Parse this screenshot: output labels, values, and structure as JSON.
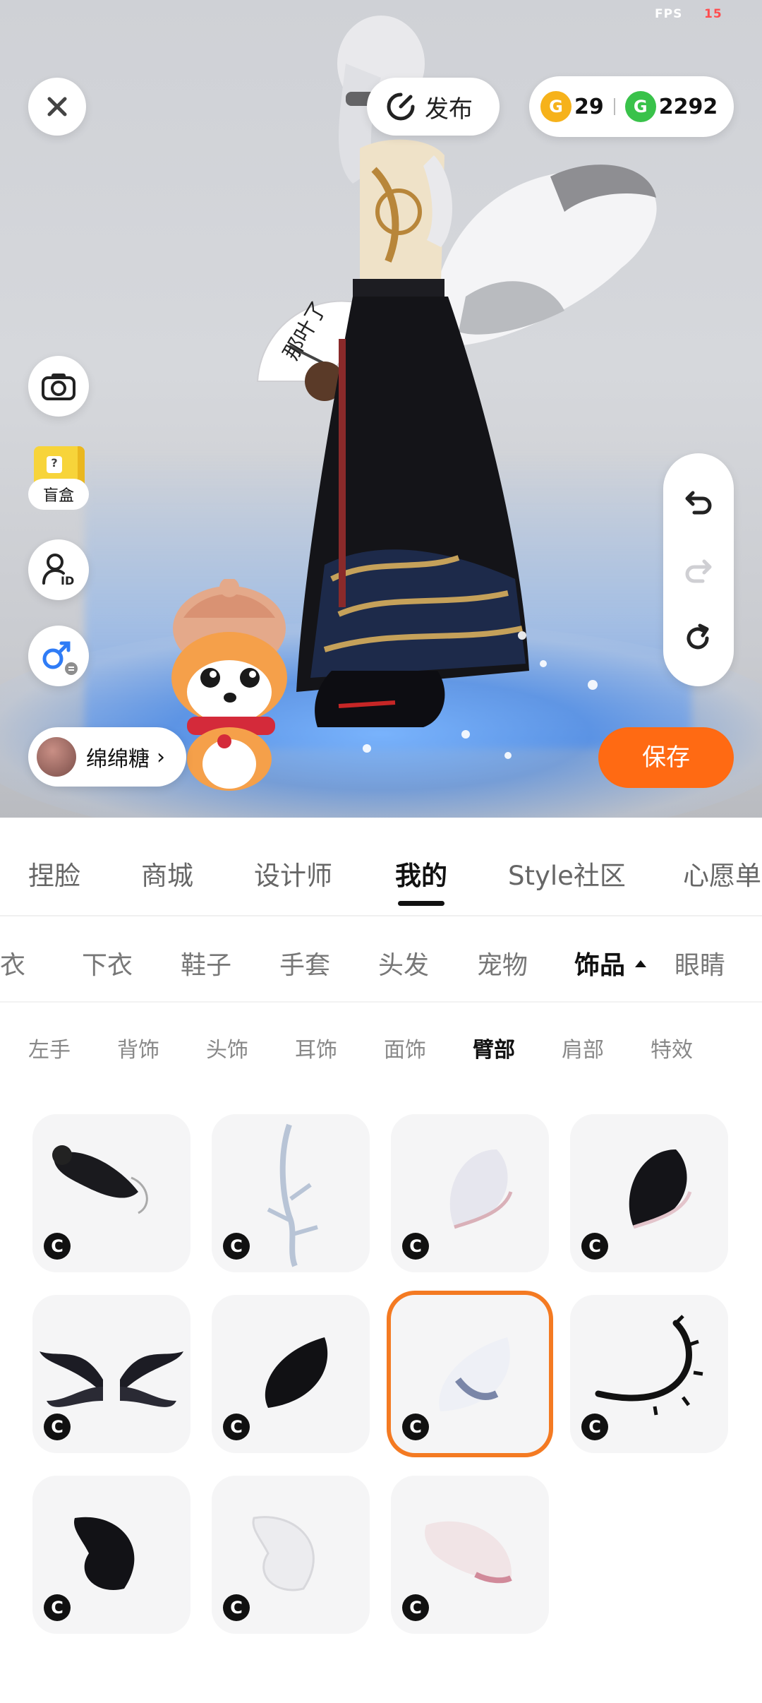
{
  "fps": {
    "label": "FPS",
    "value": "15"
  },
  "header": {
    "publish_label": "发布",
    "gold_coins": "29",
    "green_coins": "2292"
  },
  "side": {
    "blindbox_label": "盲盒"
  },
  "user": {
    "name": "绵绵糖"
  },
  "actions": {
    "save_label": "保存"
  },
  "tabs_primary": [
    {
      "label": "捏脸"
    },
    {
      "label": "商城"
    },
    {
      "label": "设计师"
    },
    {
      "label": "我的",
      "active": true
    },
    {
      "label": "Style社区"
    },
    {
      "label": "心愿单"
    }
  ],
  "tabs_category": [
    {
      "label": "上衣"
    },
    {
      "label": "下衣"
    },
    {
      "label": "鞋子"
    },
    {
      "label": "手套"
    },
    {
      "label": "头发"
    },
    {
      "label": "宠物"
    },
    {
      "label": "饰品",
      "active": true
    },
    {
      "label": "眼睛"
    }
  ],
  "tabs_sub": [
    {
      "label": "左手"
    },
    {
      "label": "背饰"
    },
    {
      "label": "头饰"
    },
    {
      "label": "耳饰"
    },
    {
      "label": "面饰"
    },
    {
      "label": "臂部",
      "active": true
    },
    {
      "label": "肩部"
    },
    {
      "label": "特效"
    }
  ],
  "items": [
    {
      "icon": "black-tail-icon",
      "badge": "C"
    },
    {
      "icon": "antler-tail-icon",
      "badge": "C"
    },
    {
      "icon": "white-round-tail-icon",
      "badge": "C"
    },
    {
      "icon": "black-round-tail-icon",
      "badge": "C"
    },
    {
      "icon": "dark-wings-icon",
      "badge": "C"
    },
    {
      "icon": "black-fluffy-tail-icon",
      "badge": "C"
    },
    {
      "icon": "white-fluffy-tail-icon",
      "badge": "C",
      "selected": true
    },
    {
      "icon": "curved-spiky-tail-icon",
      "badge": "C"
    },
    {
      "icon": "black-fur-tail-icon",
      "badge": "C"
    },
    {
      "icon": "white-fur-tail-icon",
      "badge": "C"
    },
    {
      "icon": "pink-fur-tail-icon",
      "badge": "C"
    }
  ],
  "colors": {
    "accent": "#ff6a13",
    "selected_border": "#f47a22",
    "gold": "#f6b21b",
    "green": "#39c24a"
  }
}
